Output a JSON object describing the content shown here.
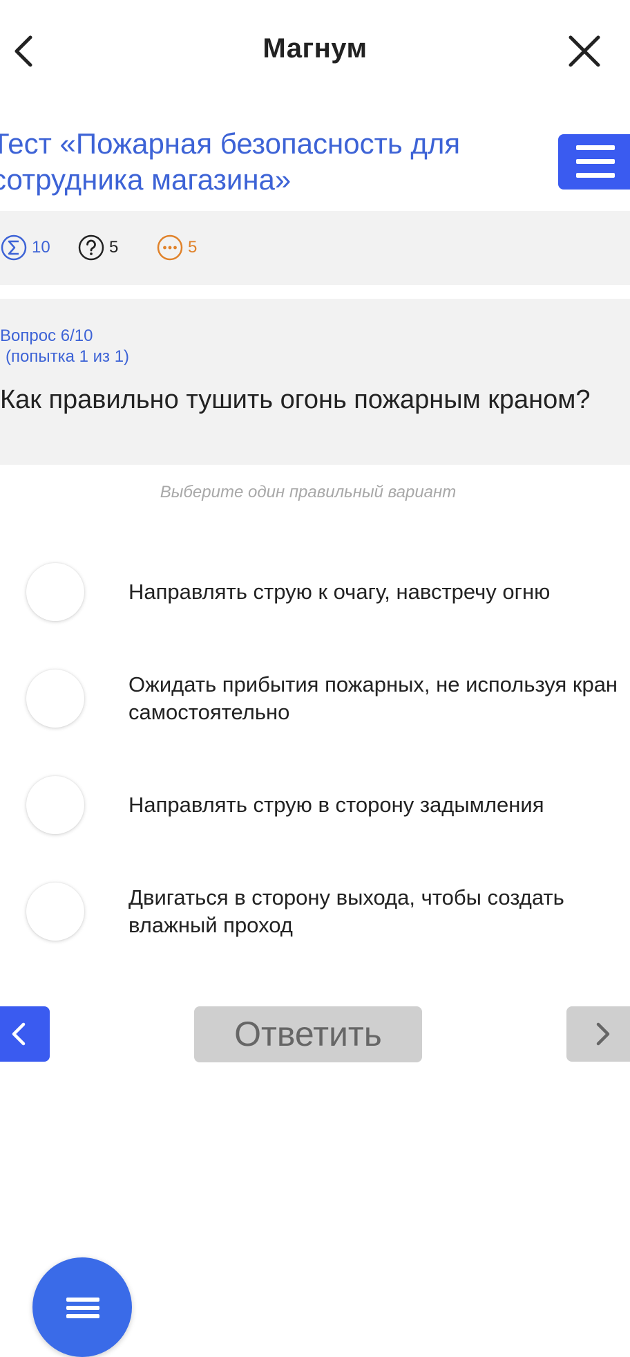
{
  "header": {
    "title": "Магнум"
  },
  "test": {
    "title": "Тест «Пожарная безопасность для\nсотрудника магазина»"
  },
  "stats": {
    "total": "10",
    "unanswered": "5",
    "pending": "5"
  },
  "question": {
    "number": "Вопрос 6/10",
    "attempt": "(попытка 1 из 1)",
    "text": "Как правильно тушить огонь пожарным краном?",
    "hint": "Выберите один правильный вариант",
    "options": [
      "Направлять струю к очагу, навстречу огню",
      "Ожидать прибытия пожарных, не используя кран самостоятельно",
      "Направлять струю в сторону задымления",
      "Двигаться в сторону выхода, чтобы создать влажный проход"
    ]
  },
  "actions": {
    "answer_label": "Ответить"
  },
  "colors": {
    "accent": "#3a5bf0",
    "link": "#3d63d6",
    "pending": "#e0822a",
    "disabled": "#cfcfcf"
  }
}
